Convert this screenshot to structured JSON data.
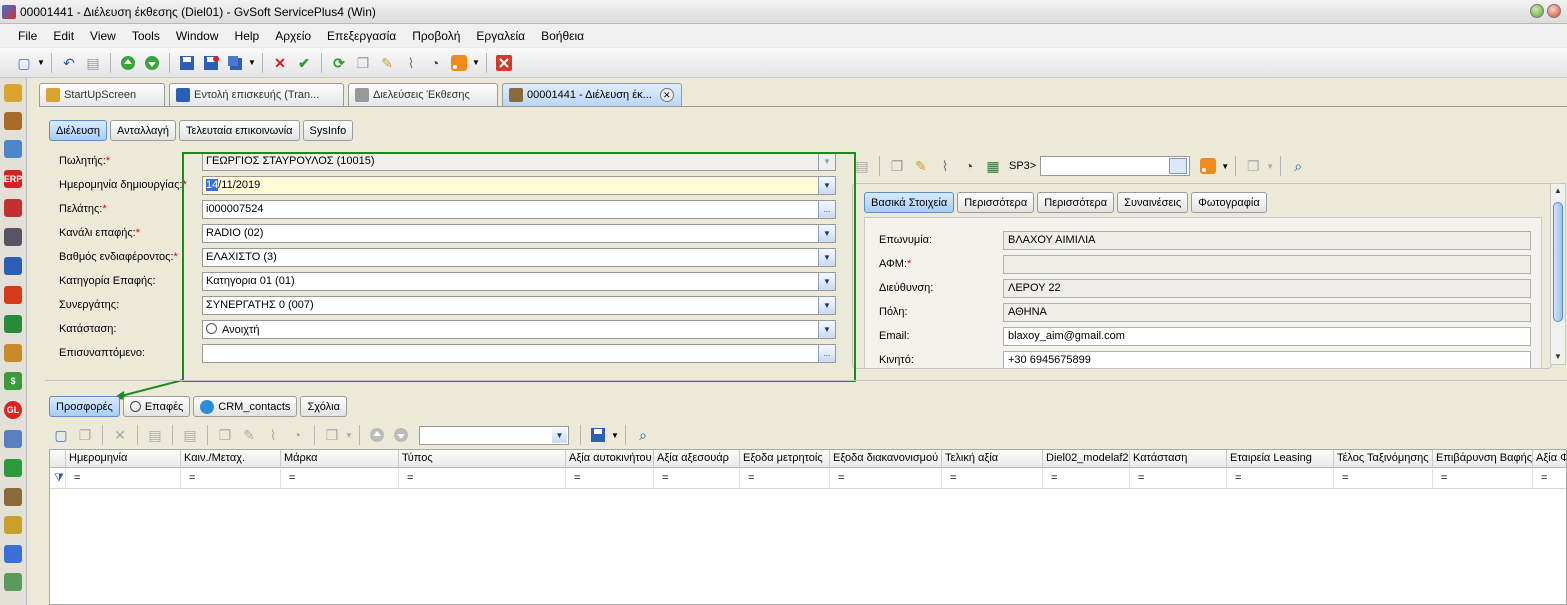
{
  "window": {
    "title": "00001441 - Διέλευση έκθεσης (Diel01) - GvSoft ServicePlus4 (Win)"
  },
  "menu": [
    "File",
    "Edit",
    "View",
    "Tools",
    "Window",
    "Help",
    "Αρχείο",
    "Επεξεργασία",
    "Προβολή",
    "Εργαλεία",
    "Βοήθεια"
  ],
  "doc_tabs": [
    {
      "label": "StartUpScreen"
    },
    {
      "label": "Εντολή επισκευής (Tran..."
    },
    {
      "label": "Διελεύσεις Έκθεσης"
    },
    {
      "label": "00001441 - Διέλευση έκ...",
      "active": true
    }
  ],
  "section_tabs": [
    "Διέλευση",
    "Ανταλλαγή",
    "Τελευταία επικοινωνία",
    "SysInfo"
  ],
  "form": [
    {
      "label": "Πωλητής:",
      "required": true,
      "value": "ΓΕΩΡΓΙΟΣ ΣΤΑΥΡΟΥΛΟΣ   (10015)",
      "button": "▼"
    },
    {
      "label": "Ημερομηνία δημιουργίας:",
      "required": true,
      "value_sel": "14",
      "value_rest": "/11/2019",
      "button": "▼"
    },
    {
      "label": "Πελάτης:",
      "required": true,
      "value": "i000007524",
      "button": "..."
    },
    {
      "label": "Κανάλι επαφής:",
      "required": true,
      "value": "RADIO (02)",
      "button": "▼"
    },
    {
      "label": "Βαθμός ενδιαφέροντος:",
      "required": true,
      "value": "ΕΛΑΧΙΣΤΟ (3)",
      "button": "▼"
    },
    {
      "label": "Κατηγορία Επαφής:",
      "required": false,
      "value": "Κατηγορια 01 (01)",
      "button": "▼"
    },
    {
      "label": "Συνεργάτης:",
      "required": false,
      "value": "ΣΥΝΕΡΓΑΤΗΣ 0 (007)",
      "button": "▼"
    },
    {
      "label": "Κατάσταση:",
      "required": false,
      "value": "Ανοιχτή",
      "button": "▼"
    },
    {
      "label": "Επισυναπτόμενο:",
      "required": false,
      "value": "",
      "button": "..."
    }
  ],
  "right_toolbar": {
    "sp3_label": "SP3>"
  },
  "customer_tabs": [
    "Βασικά Στοιχεία",
    "Περισσότερα",
    "Περισσότερα",
    "Συναινέσεις",
    "Φωτογραφία"
  ],
  "customer": [
    {
      "label": "Επωνυμία:",
      "required": false,
      "value": "ΒΛΑΧΟΥ  ΑΙΜΙΛΙΑ"
    },
    {
      "label": "ΑΦΜ:",
      "required": true,
      "value": ""
    },
    {
      "label": "Διεύθυνση:",
      "required": false,
      "value": "ΛΕΡΟΥ 22"
    },
    {
      "label": "Πόλη:",
      "required": false,
      "value": "ΑΘΗΝΑ"
    },
    {
      "label": "Email:",
      "required": false,
      "value": "blaxoy_aim@gmail.com"
    },
    {
      "label": "Κινητό:",
      "required": false,
      "value": "+30 6945675899"
    }
  ],
  "bottom_tabs": [
    "Προσφορές",
    "Επαφές",
    "CRM_contacts",
    "Σχόλια"
  ],
  "grid": {
    "columns": [
      "Ημερομηνία",
      "Καιν./Μεταχ.",
      "Μάρκα",
      "Τύπος",
      "Αξία αυτοκινήτου",
      "Αξία αξεσουάρ",
      "Εξοδα μετρητοίς",
      "Εξοδα διακανονισμού",
      "Τελική αξία",
      "Diel02_modelaf2",
      "Κατάσταση",
      "Εταιρεία Leasing",
      "Τέλος Ταξινόμησης",
      "Επιβάρυνση Βαφής",
      "Αξία Φ"
    ],
    "filter_symbol": "="
  },
  "colors": {
    "highlight_box": "#1d8a1d",
    "required": "#e00000",
    "active_tab": "#a8cdf5"
  }
}
